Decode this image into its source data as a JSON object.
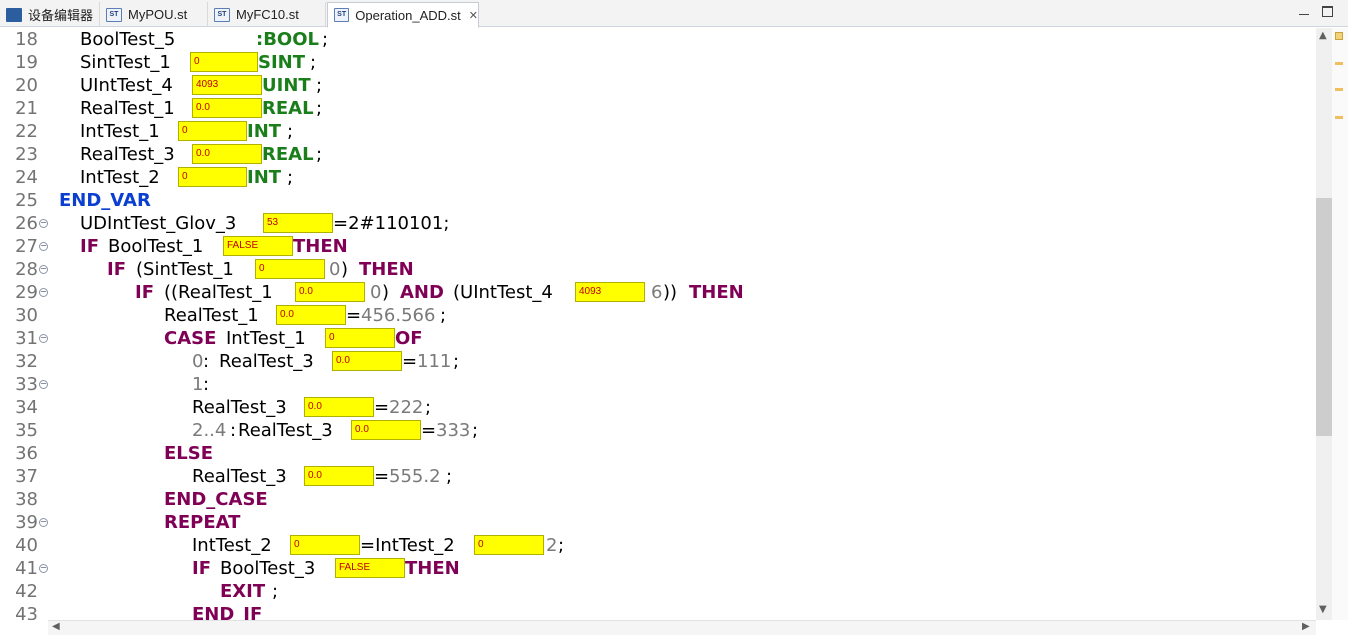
{
  "tabs": [
    {
      "label": "设备编辑器",
      "icon": "device-editor-icon"
    },
    {
      "label": "MyPOU.st",
      "icon": "st-file-icon"
    },
    {
      "label": "MyFC10.st",
      "icon": "st-file-icon"
    },
    {
      "label": "Operation_ADD.st",
      "icon": "st-file-icon",
      "active": true,
      "close": "✕"
    }
  ],
  "icon_text": {
    "st": "ST"
  },
  "lines": [
    {
      "n": "18"
    },
    {
      "n": "19"
    },
    {
      "n": "20"
    },
    {
      "n": "21"
    },
    {
      "n": "22"
    },
    {
      "n": "23"
    },
    {
      "n": "24"
    },
    {
      "n": "25"
    },
    {
      "n": "26"
    },
    {
      "n": "27"
    },
    {
      "n": "28"
    },
    {
      "n": "29"
    },
    {
      "n": "30"
    },
    {
      "n": "31"
    },
    {
      "n": "32"
    },
    {
      "n": "33"
    },
    {
      "n": "34"
    },
    {
      "n": "35"
    },
    {
      "n": "36"
    },
    {
      "n": "37"
    },
    {
      "n": "38"
    },
    {
      "n": "39"
    },
    {
      "n": "40"
    },
    {
      "n": "41"
    },
    {
      "n": "42"
    },
    {
      "n": "43"
    }
  ],
  "code": {
    "l18": {
      "id": "BoolTest_5",
      "type": ":BOOL",
      "end": ";"
    },
    "l19": {
      "id": "SintTest_1",
      "val": "0",
      "type": "SINT",
      "end": ";"
    },
    "l20": {
      "id": "UIntTest_4",
      "val": "4093",
      "type": "UINT",
      "end": ";"
    },
    "l21": {
      "id": "RealTest_1",
      "val": "0.0",
      "type": "REAL",
      "end": ";"
    },
    "l22": {
      "id": "IntTest_1",
      "val": "0",
      "type": "INT",
      "end": ";"
    },
    "l23": {
      "id": "RealTest_3",
      "val": "0.0",
      "type": "REAL",
      "end": ";"
    },
    "l24": {
      "id": "IntTest_2",
      "val": "0",
      "type": "INT",
      "end": ";"
    },
    "l25": {
      "kw": "END_VAR"
    },
    "l26": {
      "id": "UDIntTest_Glov_3",
      "val": "53",
      "rest": "=2#110101;"
    },
    "l27": {
      "kw": "IF",
      "id": "BoolTest_1",
      "val": "FALSE",
      "kw2": "THEN"
    },
    "l28": {
      "kw": "IF",
      "id": "(SintTest_1",
      "val": "0",
      "num": "0",
      "paren": ")",
      "kw2": "THEN"
    },
    "l29": {
      "kw": "IF",
      "id": "((RealTest_1",
      "val": "0.0",
      "num": "0",
      "paren": ")",
      "kw2": "AND",
      "id2": "(UIntTest_4",
      "val2": "4093",
      "num2": "6",
      "paren2": "))",
      "kw3": "THEN"
    },
    "l30": {
      "id": "RealTest_1",
      "val": "0.0",
      "eq": "=",
      "num": "456.566",
      "end": ";"
    },
    "l31": {
      "kw": "CASE",
      "id": "IntTest_1",
      "val": "0",
      "kw2": "OF"
    },
    "l32": {
      "num": "0",
      "colon": ":",
      "id": "RealTest_3",
      "val": "0.0",
      "eq": "=",
      "num2": "111",
      "end": ";"
    },
    "l33": {
      "num": "1",
      "colon": ":"
    },
    "l34": {
      "id": "RealTest_3",
      "val": "0.0",
      "eq": "=",
      "num": "222",
      "end": ";"
    },
    "l35": {
      "num": "2..4",
      "colon": ":",
      "id": "RealTest_3",
      "val": "0.0",
      "eq": "=",
      "num2": "333",
      "end": ";"
    },
    "l36": {
      "kw": "ELSE"
    },
    "l37": {
      "id": "RealTest_3",
      "val": "0.0",
      "eq": "=",
      "num": "555.2",
      "end": ";"
    },
    "l38": {
      "kw": "END_CASE"
    },
    "l39": {
      "kw": "REPEAT"
    },
    "l40": {
      "id": "IntTest_2",
      "val": "0",
      "eq": "=IntTest_2",
      "val2": "0",
      "num": "2",
      "end": ";"
    },
    "l41": {
      "kw": "IF",
      "id": "BoolTest_3",
      "val": "FALSE",
      "kw2": "THEN"
    },
    "l42": {
      "kw": "EXIT",
      "end": ";"
    },
    "l43": {
      "kw": "END_IF"
    }
  },
  "colors": {
    "keyword": "#7f0055",
    "end_var": "#0a3fcf",
    "type": "#1a7f1a",
    "monitor_bg": "#ffff00",
    "monitor_text": "#c00000"
  }
}
